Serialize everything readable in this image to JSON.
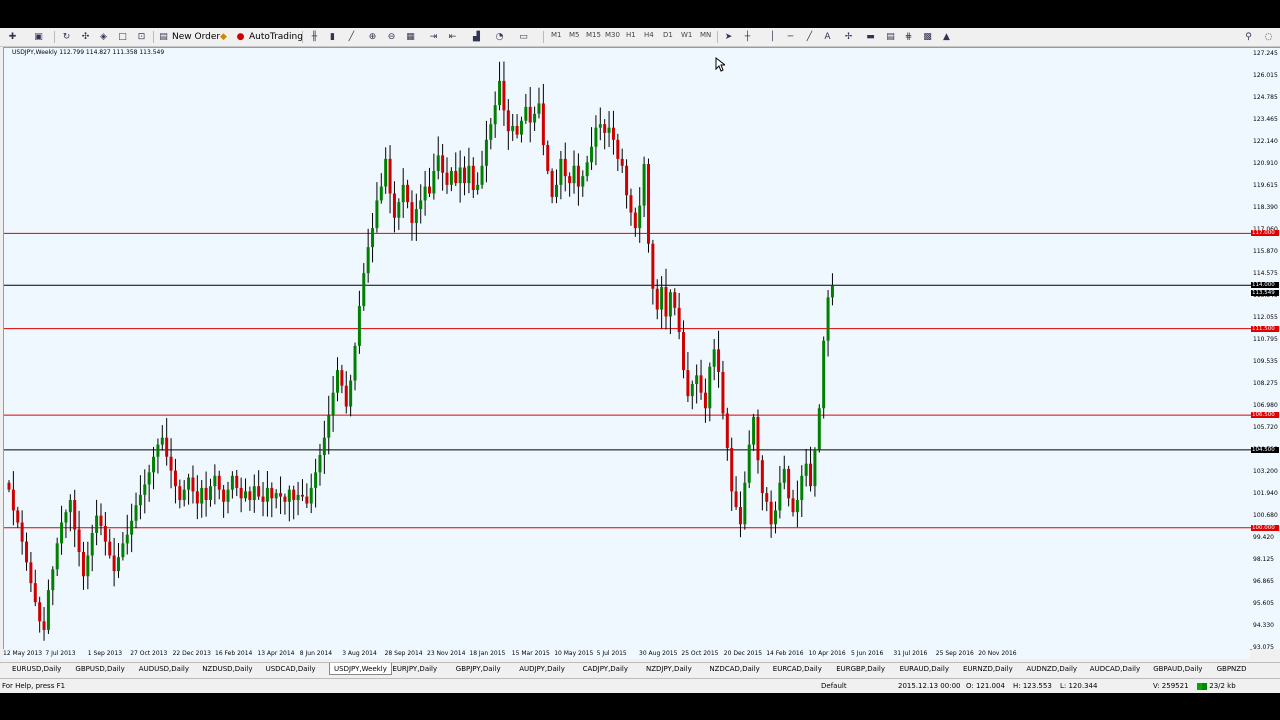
{
  "toolbar": {
    "new_order": "New Order",
    "autotrading": "AutoTrading",
    "timeframes": [
      "M1",
      "M5",
      "M15",
      "M30",
      "H1",
      "H4",
      "D1",
      "W1",
      "MN"
    ]
  },
  "chart": {
    "symbol_info": "USDJPY,Weekly  112.799 114.827 111.358 113.549",
    "price_labels": [
      "127.245",
      "126.015",
      "124.785",
      "123.465",
      "122.140",
      "120.910",
      "119.615",
      "118.390",
      "117.060",
      "115.870",
      "114.575",
      "113.345",
      "112.055",
      "110.795",
      "109.535",
      "108.275",
      "106.980",
      "105.720",
      "104.500",
      "103.200",
      "101.940",
      "100.680",
      "99.420",
      "98.125",
      "96.865",
      "95.605",
      "94.330",
      "93.075"
    ],
    "level_labels": {
      "l117": "117.000",
      "l114": "114.000",
      "l113": "113.549",
      "l1115": "111.500",
      "l1065": "106.500",
      "l1045": "104.500",
      "l100": "100.000"
    },
    "dates": [
      "12 May 2013",
      "7 Jul 2013",
      "1 Sep 2013",
      "27 Oct 2013",
      "22 Dec 2013",
      "16 Feb 2014",
      "13 Apr 2014",
      "8 Jun 2014",
      "3 Aug 2014",
      "28 Sep 2014",
      "23 Nov 2014",
      "18 Jan 2015",
      "15 Mar 2015",
      "10 May 2015",
      "5 Jul 2015",
      "30 Aug 2015",
      "25 Oct 2015",
      "20 Dec 2015",
      "14 Feb 2016",
      "10 Apr 2016",
      "5 Jun 2016",
      "31 Jul 2016",
      "25 Sep 2016",
      "20 Nov 2016"
    ],
    "colors": {
      "bull": "#008000",
      "bear": "#cc0000",
      "bg": "#f0f8ff",
      "support": "#e00000",
      "key": "#000000"
    }
  },
  "chart_data": {
    "type": "candlestick",
    "title": "USDJPY,Weekly",
    "ylim": [
      93.0,
      127.7
    ],
    "horizontal_lines": [
      117.0,
      114.0,
      111.5,
      106.5,
      104.5,
      100.0
    ],
    "closes": [
      102.2,
      101.0,
      100.3,
      99.2,
      98.0,
      96.8,
      95.7,
      94.6,
      94.1,
      96.4,
      97.6,
      99.1,
      100.3,
      100.9,
      101.6,
      99.9,
      98.6,
      97.2,
      98.4,
      99.7,
      100.7,
      100.1,
      99.2,
      98.4,
      97.5,
      98.3,
      99.1,
      99.6,
      100.4,
      101.3,
      101.9,
      102.5,
      103.2,
      104.1,
      104.8,
      105.2,
      104.1,
      103.3,
      102.4,
      101.6,
      102.2,
      102.9,
      102.1,
      101.4,
      102.3,
      101.6,
      102.4,
      103.0,
      102.2,
      101.5,
      102.2,
      103.0,
      102.3,
      101.7,
      102.1,
      101.6,
      102.4,
      101.8,
      101.5,
      102.3,
      101.7,
      102.0,
      101.8,
      101.5,
      102.2,
      101.6,
      101.9,
      101.8,
      101.4,
      102.3,
      103.2,
      104.2,
      105.2,
      106.5,
      107.8,
      109.1,
      108.2,
      107.0,
      108.5,
      110.5,
      112.8,
      114.7,
      116.2,
      117.3,
      118.9,
      119.7,
      121.3,
      119.3,
      117.9,
      118.8,
      119.8,
      118.8,
      117.6,
      118.4,
      118.9,
      119.7,
      119.3,
      120.6,
      121.5,
      120.5,
      119.8,
      120.6,
      119.9,
      120.8,
      119.9,
      120.9,
      119.5,
      119.8,
      120.9,
      122.4,
      123.3,
      124.4,
      125.8,
      124.1,
      122.9,
      123.2,
      122.7,
      123.5,
      124.3,
      123.4,
      123.9,
      124.5,
      122.1,
      120.6,
      119.1,
      119.8,
      121.3,
      120.3,
      119.9,
      120.9,
      119.7,
      120.3,
      121.1,
      122.0,
      123.1,
      123.3,
      122.8,
      123.1,
      122.4,
      121.3,
      120.9,
      119.2,
      118.2,
      117.3,
      118.6,
      121.0,
      116.4,
      113.8,
      112.6,
      113.9,
      112.2,
      113.6,
      112.7,
      111.3,
      109.1,
      107.6,
      108.3,
      108.8,
      107.8,
      106.9,
      109.3,
      110.3,
      109.0,
      106.6,
      104.6,
      102.1,
      101.2,
      100.2,
      102.6,
      104.8,
      106.4,
      103.9,
      102.0,
      101.5,
      100.2,
      101.0,
      102.6,
      103.4,
      101.7,
      100.9,
      101.6,
      103.0,
      103.7,
      102.4,
      104.5,
      106.9,
      110.8,
      113.3,
      114.0
    ]
  },
  "tabs": [
    "EURUSD,Daily",
    "GBPUSD,Daily",
    "AUDUSD,Daily",
    "NZDUSD,Daily",
    "USDCAD,Daily",
    "USDJPY,Weekly",
    "EURJPY,Daily",
    "GBPJPY,Daily",
    "AUDJPY,Daily",
    "CADJPY,Daily",
    "NZDJPY,Daily",
    "NZDCAD,Daily",
    "EURCAD,Daily",
    "EURGBP,Daily",
    "EURAUD,Daily",
    "EURNZD,Daily",
    "AUDNZD,Daily",
    "AUDCAD,Daily",
    "GBPAUD,Daily",
    "GBPNZD"
  ],
  "status": {
    "help": "For Help, press F1",
    "profile": "Default",
    "datetime": "2015.12.13 00:00",
    "open": "O: 121.004",
    "high": "H: 123.553",
    "low": "L: 120.344",
    "volume": "V: 259521",
    "traffic": "23/2 kb"
  }
}
